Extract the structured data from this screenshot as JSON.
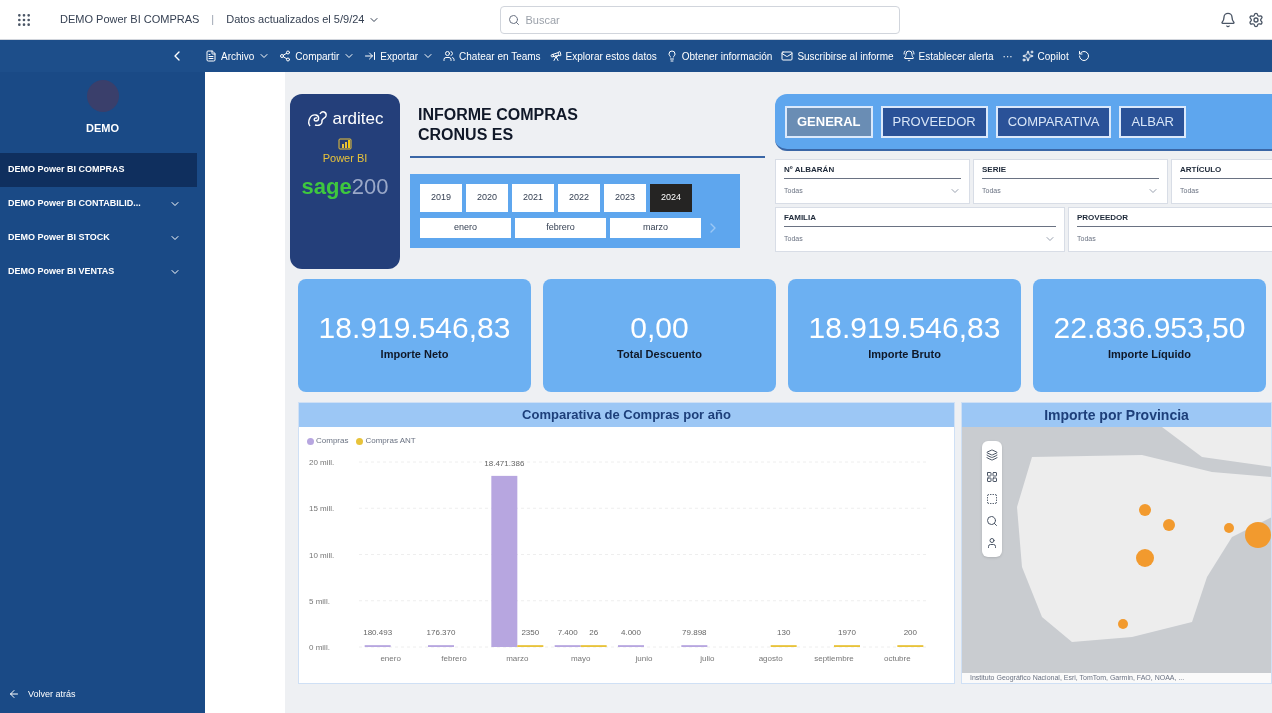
{
  "top_bar": {
    "app_title": "DEMO Power BI COMPRAS",
    "separator": "|",
    "updated": "Datos actualizados el 5/9/24",
    "search": {
      "placeholder": "Buscar"
    }
  },
  "command_bar": [
    {
      "label": "Archivo",
      "dropdown": true,
      "kind": "file"
    },
    {
      "label": "Compartir",
      "dropdown": true,
      "kind": "share"
    },
    {
      "label": "Exportar",
      "dropdown": true,
      "kind": "export"
    },
    {
      "label": "Chatear en Teams",
      "dropdown": false,
      "kind": "teams"
    },
    {
      "label": "Explorar estos datos",
      "dropdown": false,
      "kind": "explore"
    },
    {
      "label": "Obtener información",
      "dropdown": false,
      "kind": "insight"
    },
    {
      "label": "Suscribirse al informe",
      "dropdown": false,
      "kind": "subscribe"
    },
    {
      "label": "Establecer alerta",
      "dropdown": false,
      "kind": "alert"
    },
    {
      "label": "···",
      "dropdown": false,
      "kind": "more"
    },
    {
      "label": "Copilot",
      "dropdown": false,
      "kind": "copilot"
    }
  ],
  "sidebar": {
    "workspace": "DEMO",
    "items": [
      {
        "label": "DEMO Power BI COMPRAS",
        "selected": true,
        "expandable": false
      },
      {
        "label": "DEMO Power BI CONTABILID...",
        "selected": false,
        "expandable": true
      },
      {
        "label": "DEMO Power BI STOCK",
        "selected": false,
        "expandable": true
      },
      {
        "label": "DEMO Power BI VENTAS",
        "selected": false,
        "expandable": true
      }
    ],
    "back": "Volver atrás"
  },
  "report": {
    "logo": {
      "brand": "arditec",
      "product": "Power BI",
      "sage": "sage",
      "sage_number": "200"
    },
    "title": [
      "INFORME COMPRAS",
      "CRONUS ES"
    ],
    "years": [
      {
        "label": "2019",
        "selected": false
      },
      {
        "label": "2020",
        "selected": false
      },
      {
        "label": "2021",
        "selected": false
      },
      {
        "label": "2022",
        "selected": false
      },
      {
        "label": "2023",
        "selected": false
      },
      {
        "label": "2024",
        "selected": true
      }
    ],
    "months": [
      {
        "label": "enero",
        "selected": false
      },
      {
        "label": "febrero",
        "selected": false
      },
      {
        "label": "marzo",
        "selected": false
      }
    ],
    "tabs": [
      {
        "label": "GENERAL",
        "selected": true
      },
      {
        "label": "PROVEEDOR",
        "selected": false
      },
      {
        "label": "COMPARATIVA",
        "selected": false
      },
      {
        "label": "ALBAR",
        "selected": false
      }
    ],
    "filters": [
      [
        {
          "label": "Nº ALBARÁN",
          "value": "Todas"
        },
        {
          "label": "SERIE",
          "value": "Todas"
        },
        {
          "label": "ARTÍCULO",
          "value": "Todas"
        }
      ],
      [
        {
          "label": "FAMILIA",
          "value": "Todas"
        },
        {
          "label": "PROVEEDOR",
          "value": "Todas"
        }
      ]
    ],
    "kpis": [
      {
        "value": "18.919.546,83",
        "label": "Importe Neto"
      },
      {
        "value": "0,00",
        "label": "Total Descuento"
      },
      {
        "value": "18.919.546,83",
        "label": "Importe Bruto"
      },
      {
        "value": "22.836.953,50",
        "label": "Importe Líquido"
      }
    ],
    "bar_chart": {
      "chart_data": {
        "type": "bar",
        "title": "Comparativa de Compras por año",
        "categories": [
          "enero",
          "febrero",
          "marzo",
          "mayo",
          "junio",
          "julio",
          "agosto",
          "septiembre",
          "octubre"
        ],
        "series": [
          {
            "name": "Compras",
            "color": "#b7a6e0",
            "values": [
              0.2,
              0.2,
              18.5,
              0.2,
              0.2,
              0.2,
              null,
              null,
              null
            ]
          },
          {
            "name": "Compras ANT",
            "color": "#e8c33a",
            "values": [
              null,
              null,
              0.2,
              0.2,
              null,
              null,
              0.2,
              0.2,
              0.2
            ]
          }
        ],
        "grid": true,
        "value_labels": [
          [
            "180.493",
            "176.370",
            "18.471.386",
            "7.400",
            "4.000",
            "79.898",
            null,
            null,
            null
          ],
          [
            null,
            null,
            "2350",
            "26",
            null,
            null,
            "130",
            "1970",
            "200"
          ]
        ],
        "ylim": [
          0,
          20
        ],
        "yticks": [
          {
            "value": 0,
            "label": "0 mill."
          },
          {
            "value": 5,
            "label": "5 mill."
          },
          {
            "value": 10,
            "label": "10 mill."
          },
          {
            "value": 15,
            "label": "15 mill."
          },
          {
            "value": 20,
            "label": "20 mill."
          }
        ]
      }
    },
    "map": {
      "title": "Importe por Provincia",
      "attribution": "Instituto Geográfico Nacional, Esri, TomTom, Garmin, FAO, NOAA, ..."
    }
  }
}
